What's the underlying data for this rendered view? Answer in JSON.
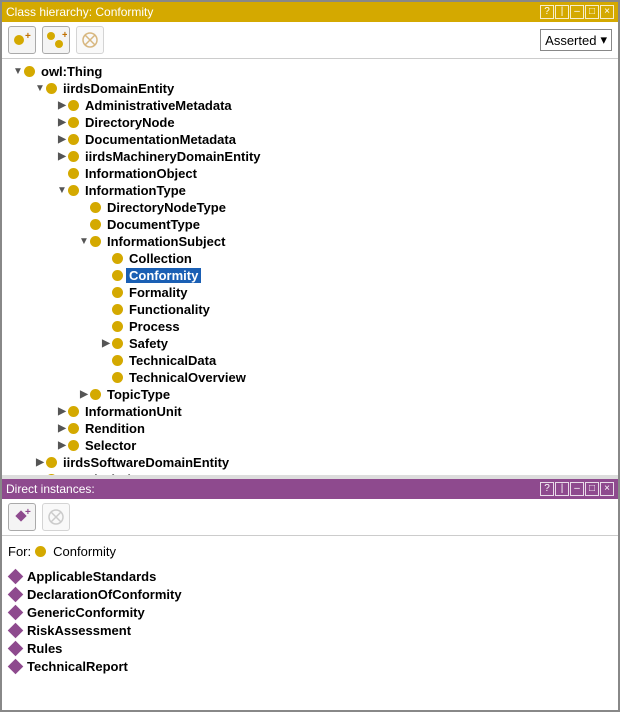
{
  "hierarchyPanel": {
    "titlePrefix": "Class hierarchy: ",
    "titleClass": "Conformity",
    "viewMode": "Asserted",
    "toolbar": {
      "addSibling": "add-class-sibling",
      "addChild": "add-class-child",
      "delete": "delete-class"
    },
    "tree": [
      {
        "depth": 0,
        "expander": "down",
        "label": "owl:Thing"
      },
      {
        "depth": 1,
        "expander": "down",
        "label": "iirdsDomainEntity"
      },
      {
        "depth": 2,
        "expander": "right",
        "label": "AdministrativeMetadata"
      },
      {
        "depth": 2,
        "expander": "right",
        "label": "DirectoryNode"
      },
      {
        "depth": 2,
        "expander": "right",
        "label": "DocumentationMetadata"
      },
      {
        "depth": 2,
        "expander": "right",
        "label": "iirdsMachineryDomainEntity"
      },
      {
        "depth": 2,
        "expander": "none",
        "label": "InformationObject"
      },
      {
        "depth": 2,
        "expander": "down",
        "label": "InformationType"
      },
      {
        "depth": 3,
        "expander": "none",
        "label": "DirectoryNodeType"
      },
      {
        "depth": 3,
        "expander": "none",
        "label": "DocumentType"
      },
      {
        "depth": 3,
        "expander": "down",
        "label": "InformationSubject"
      },
      {
        "depth": 4,
        "expander": "none",
        "label": "Collection"
      },
      {
        "depth": 4,
        "expander": "none",
        "label": "Conformity",
        "selected": true
      },
      {
        "depth": 4,
        "expander": "none",
        "label": "Formality"
      },
      {
        "depth": 4,
        "expander": "none",
        "label": "Functionality"
      },
      {
        "depth": 4,
        "expander": "none",
        "label": "Process"
      },
      {
        "depth": 4,
        "expander": "right",
        "label": "Safety"
      },
      {
        "depth": 4,
        "expander": "none",
        "label": "TechnicalData"
      },
      {
        "depth": 4,
        "expander": "none",
        "label": "TechnicalOverview"
      },
      {
        "depth": 3,
        "expander": "right",
        "label": "TopicType"
      },
      {
        "depth": 2,
        "expander": "right",
        "label": "InformationUnit"
      },
      {
        "depth": 2,
        "expander": "right",
        "label": "Rendition"
      },
      {
        "depth": 2,
        "expander": "right",
        "label": "Selector"
      },
      {
        "depth": 1,
        "expander": "right",
        "label": "iirdsSoftwareDomainEntity"
      },
      {
        "depth": 1,
        "expander": "none",
        "label": "vcard:Kind"
      }
    ]
  },
  "instancesPanel": {
    "title": "Direct instances:",
    "forLabel": "For:",
    "forClass": "Conformity",
    "instances": [
      "ApplicableStandards",
      "DeclarationOfConformity",
      "GenericConformity",
      "RiskAssessment",
      "Rules",
      "TechnicalReport"
    ]
  },
  "windowControls": [
    "?",
    "|",
    "–",
    "□",
    "×"
  ]
}
